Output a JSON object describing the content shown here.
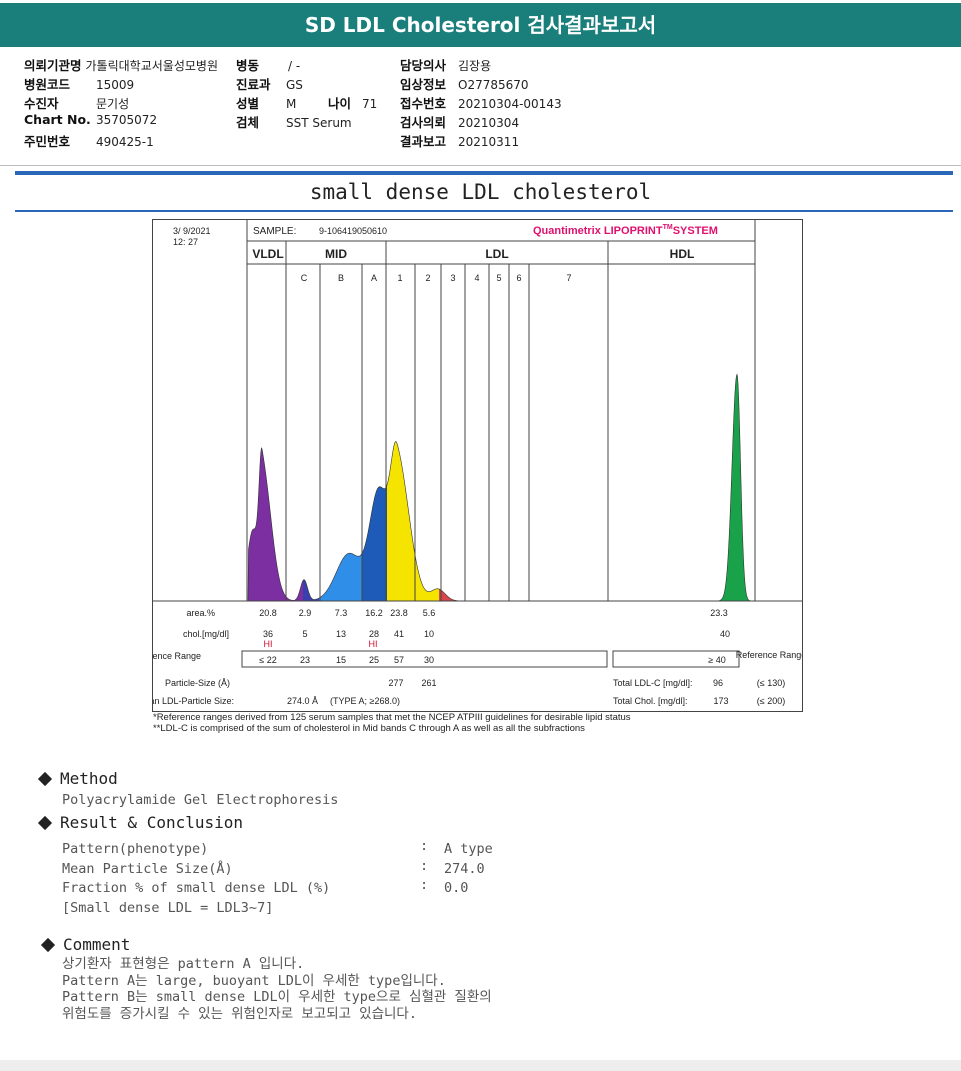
{
  "header": {
    "title": "SD LDL Cholesterol 검사결과보고서"
  },
  "info": {
    "col1": [
      {
        "label": "의뢰기관명",
        "value": "가톨릭대학교서울성모병원"
      },
      {
        "label": "병원코드",
        "value": "15009"
      },
      {
        "label": "수진자",
        "value": "문기성"
      },
      {
        "label": "Chart No.",
        "value": "35705072"
      },
      {
        "label": "주민번호",
        "value": "490425-1"
      }
    ],
    "col2": [
      {
        "label": "병동",
        "value": "/ -"
      },
      {
        "label": "진료과",
        "value": "GS"
      },
      {
        "label": "성별",
        "value": "M"
      },
      {
        "label": "검체",
        "value": "SST Serum"
      }
    ],
    "age": {
      "label": "나이",
      "value": "71"
    },
    "col3": [
      {
        "label": "담당의사",
        "value": "김장용"
      },
      {
        "label": "임상정보",
        "value": "O27785670"
      },
      {
        "label": "접수번호",
        "value": "20210304-00143"
      },
      {
        "label": "검사의뢰",
        "value": "20210304"
      },
      {
        "label": "결과보고",
        "value": "20210311"
      }
    ]
  },
  "report_title": "small dense LDL cholesterol",
  "chart_data": {
    "type": "area",
    "datetime": [
      "3/ 9/2021",
      "12: 27"
    ],
    "sample_label": "SAMPLE:",
    "sample_id": "9-106419050610",
    "system": "Quantimetrix LIPOPRINT",
    "system_tm": "TM",
    "system_suffix": "SYSTEM",
    "groups": [
      "VLDL",
      "MID",
      "LDL",
      "HDL"
    ],
    "bands": [
      "C",
      "B",
      "A",
      "1",
      "2",
      "3",
      "4",
      "5",
      "6",
      "7"
    ],
    "series": [
      {
        "band": "VLDL",
        "color": "#7b2fa0",
        "area": 20.8,
        "chol": 36
      },
      {
        "band": "C",
        "color": "#3a3fae",
        "area": 2.9,
        "chol": 5
      },
      {
        "band": "B",
        "color": "#2f8fe8",
        "area": 7.3,
        "chol": 13
      },
      {
        "band": "A",
        "color": "#1e5bb8",
        "area": 16.2,
        "chol": 28
      },
      {
        "band": "1",
        "color": "#f5e300",
        "area": 23.8,
        "chol": 41
      },
      {
        "band": "2",
        "color": "#f5e300",
        "area": 5.6,
        "chol": 10
      },
      {
        "band": "HDL",
        "color": "#19a24a",
        "area": 23.3,
        "chol": 40
      }
    ],
    "rows": {
      "area_label": "area.%",
      "area_values": [
        "20.8",
        "2.9",
        "7.3",
        "16.2",
        "23.8",
        "5.6"
      ],
      "area_hdl": "23.3",
      "chol_label": "chol.[mg/dl]",
      "chol_values": [
        "36",
        "5",
        "13",
        "28",
        "41",
        "10"
      ],
      "chol_hdl": "40",
      "hi_flags": [
        "HI",
        "HI"
      ],
      "ref_label": "Reference Range",
      "ref_values": [
        "≤ 22",
        "23",
        "15",
        "25",
        "57",
        "30"
      ],
      "ref_hdl": "≥ 40",
      "ref_right_label": "Reference Range",
      "particle_label": "Particle-Size (Å)",
      "particle_values": [
        "277",
        "261"
      ],
      "mean_label": "Mean LDL-Particle Size:",
      "mean_value": "274.0 Å",
      "mean_type": "(TYPE A; ≥268.0)",
      "total_ldl_label": "Total LDL-C [mg/dl]:",
      "total_ldl_value": "96",
      "total_ldl_ref": "(≤ 130)",
      "total_chol_label": "Total Chol. [mg/dl]:",
      "total_chol_value": "173",
      "total_chol_ref": "(≤ 200)"
    },
    "footnotes": [
      "*Reference ranges derived from 125 serum samples that met the NCEP ATPIII guidelines for desirable lipid status",
      "**LDL-C is comprised of the sum of cholesterol in Mid bands C through A as well as all the subfractions"
    ]
  },
  "method": {
    "title": "Method",
    "text": "Polyacrylamide Gel Electrophoresis"
  },
  "result": {
    "title": "Result & Conclusion",
    "rows": [
      {
        "label": "Pattern(phenotype)",
        "sep": ":",
        "value": "A type"
      },
      {
        "label": "Mean Particle Size(Å)",
        "sep": ":",
        "value": "274.0"
      },
      {
        "label": "Fraction % of small dense LDL (%)",
        "sep": ":",
        "value": "0.0"
      }
    ],
    "note": "[Small dense LDL = LDL3~7]"
  },
  "comment": {
    "title": "Comment",
    "lines": [
      "상기환자 표현형은 pattern A 입니다.",
      "Pattern A는 large, buoyant LDL이 우세한 type입니다.",
      "Pattern B는 small dense LDL이 우세한 type으로 심혈관 질환의",
      "위험도를 증가시킬 수 있는 위험인자로 보고되고 있습니다."
    ]
  }
}
